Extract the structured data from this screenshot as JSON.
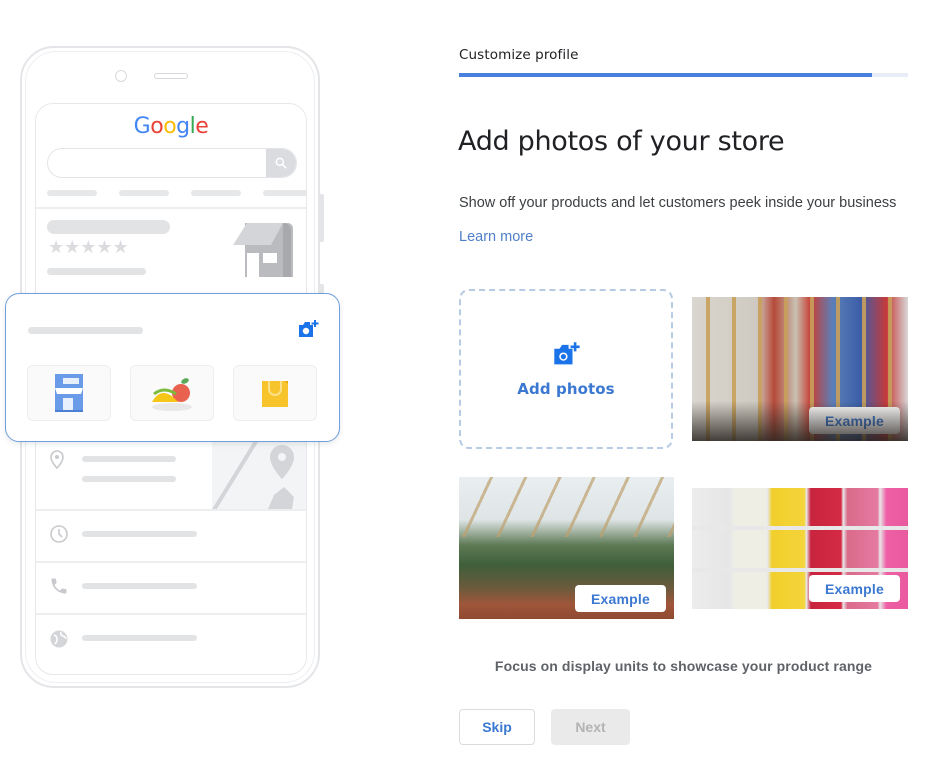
{
  "header": {
    "step_label": "Customize profile",
    "progress_fraction": 0.92
  },
  "main": {
    "title": "Add photos of your store",
    "subtitle": "Show off your products and let customers peek inside your business",
    "learn_more": "Learn more",
    "add_photos_label": "Add photos",
    "examples": [
      {
        "label": "Example",
        "subject": "hardware store tool display"
      },
      {
        "label": "Example",
        "subject": "garden center plant display"
      },
      {
        "label": "Example",
        "subject": "candle shelf display"
      }
    ],
    "tip": "Focus on display units to showcase your product range"
  },
  "actions": {
    "skip_label": "Skip",
    "next_label": "Next",
    "next_enabled": false
  },
  "phone_preview": {
    "brand_letters": [
      "G",
      "o",
      "o",
      "g",
      "l",
      "e"
    ],
    "brand_colors": [
      "#4285F4",
      "#EA4335",
      "#FBBC05",
      "#4285F4",
      "#34A853",
      "#EA4335"
    ],
    "rating_stars": "★★★★★",
    "icons": [
      "search-icon",
      "store-icon",
      "add-photo-icon",
      "location-pin-icon",
      "map-pin-icon",
      "clock-icon",
      "phone-icon",
      "globe-icon"
    ],
    "categories": [
      "storefront-icon",
      "food-icon",
      "shopping-bag-icon"
    ]
  },
  "colors": {
    "accent": "#3b78d1",
    "progress": "#4a80dd",
    "card_border": "#6f9fdc",
    "dashed_border": "#b7cbe4"
  }
}
